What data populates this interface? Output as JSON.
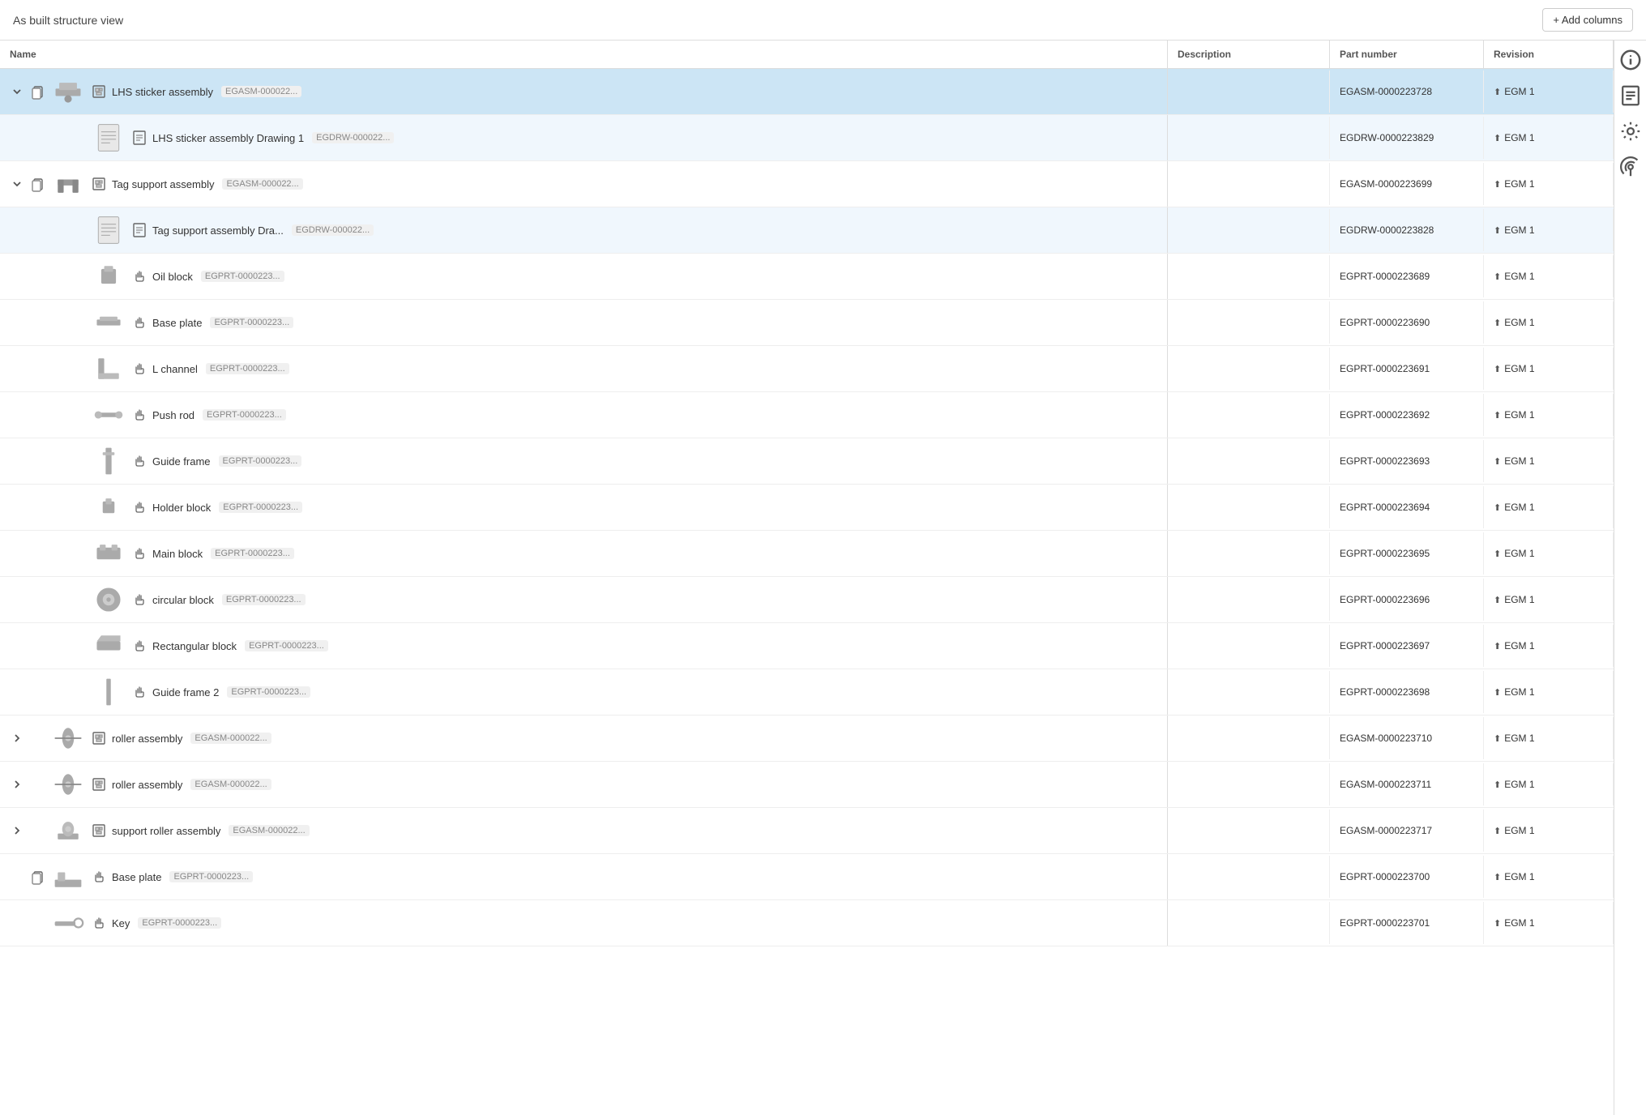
{
  "header": {
    "title": "As built structure view",
    "add_columns_label": "+ Add columns"
  },
  "columns": {
    "name": "Name",
    "description": "Description",
    "part_number": "Part number",
    "revision": "Revision"
  },
  "rows": [
    {
      "id": "lhs-sticker-asm",
      "level": 0,
      "expanded": true,
      "selected": true,
      "has_children": true,
      "has_copy_icon": true,
      "type": "assembly",
      "name": "LHS sticker assembly",
      "tag": "EGASM-000022...",
      "description": "",
      "part_number": "EGASM-0000223728",
      "revision": "EGM 1",
      "thumb_shape": "complex"
    },
    {
      "id": "lhs-sticker-drw",
      "level": 1,
      "expanded": false,
      "selected": false,
      "has_children": false,
      "has_copy_icon": false,
      "type": "drawing",
      "name": "LHS sticker assembly Drawing 1",
      "tag": "EGDRW-000022...",
      "description": "",
      "part_number": "EGDRW-0000223829",
      "revision": "EGM 1",
      "thumb_shape": "document",
      "sub_row": true
    },
    {
      "id": "tag-support-asm",
      "level": 0,
      "expanded": true,
      "selected": false,
      "has_children": true,
      "has_copy_icon": true,
      "type": "assembly",
      "name": "Tag support assembly",
      "tag": "EGASM-000022...",
      "description": "",
      "part_number": "EGASM-0000223699",
      "revision": "EGM 1",
      "thumb_shape": "bracket"
    },
    {
      "id": "tag-support-drw",
      "level": 1,
      "expanded": false,
      "selected": false,
      "has_children": false,
      "has_copy_icon": false,
      "type": "drawing",
      "name": "Tag support assembly Dra...",
      "tag": "EGDRW-000022...",
      "description": "",
      "part_number": "EGDRW-0000223828",
      "revision": "EGM 1",
      "thumb_shape": "document",
      "sub_row": true
    },
    {
      "id": "oil-block",
      "level": 1,
      "expanded": false,
      "selected": false,
      "has_children": false,
      "has_copy_icon": false,
      "type": "part",
      "name": "Oil block",
      "tag": "EGPRT-0000223...",
      "description": "",
      "part_number": "EGPRT-0000223689",
      "revision": "EGM 1",
      "thumb_shape": "small-block"
    },
    {
      "id": "base-plate",
      "level": 1,
      "expanded": false,
      "selected": false,
      "has_children": false,
      "has_copy_icon": false,
      "type": "part",
      "name": "Base plate",
      "tag": "EGPRT-0000223...",
      "description": "",
      "part_number": "EGPRT-0000223690",
      "revision": "EGM 1",
      "thumb_shape": "plate"
    },
    {
      "id": "l-channel",
      "level": 1,
      "expanded": false,
      "selected": false,
      "has_children": false,
      "has_copy_icon": false,
      "type": "part",
      "name": "L channel",
      "tag": "EGPRT-0000223...",
      "description": "",
      "part_number": "EGPRT-0000223691",
      "revision": "EGM 1",
      "thumb_shape": "l-channel"
    },
    {
      "id": "push-rod",
      "level": 1,
      "expanded": false,
      "selected": false,
      "has_children": false,
      "has_copy_icon": false,
      "type": "part",
      "name": "Push rod",
      "tag": "EGPRT-0000223...",
      "description": "",
      "part_number": "EGPRT-0000223692",
      "revision": "EGM 1",
      "thumb_shape": "rod"
    },
    {
      "id": "guide-frame",
      "level": 1,
      "expanded": false,
      "selected": false,
      "has_children": false,
      "has_copy_icon": false,
      "type": "part",
      "name": "Guide frame",
      "tag": "EGPRT-0000223...",
      "description": "",
      "part_number": "EGPRT-0000223693",
      "revision": "EGM 1",
      "thumb_shape": "thin-frame"
    },
    {
      "id": "holder-block",
      "level": 1,
      "expanded": false,
      "selected": false,
      "has_children": false,
      "has_copy_icon": false,
      "type": "part",
      "name": "Holder block",
      "tag": "EGPRT-0000223...",
      "description": "",
      "part_number": "EGPRT-0000223694",
      "revision": "EGM 1",
      "thumb_shape": "small-block2"
    },
    {
      "id": "main-block",
      "level": 1,
      "expanded": false,
      "selected": false,
      "has_children": false,
      "has_copy_icon": false,
      "type": "part",
      "name": "Main block",
      "tag": "EGPRT-0000223...",
      "description": "",
      "part_number": "EGPRT-0000223695",
      "revision": "EGM 1",
      "thumb_shape": "main-block"
    },
    {
      "id": "circular-block",
      "level": 1,
      "expanded": false,
      "selected": false,
      "has_children": false,
      "has_copy_icon": false,
      "type": "part",
      "name": "circular block",
      "tag": "EGPRT-0000223...",
      "description": "",
      "part_number": "EGPRT-0000223696",
      "revision": "EGM 1",
      "thumb_shape": "circular"
    },
    {
      "id": "rectangular-block",
      "level": 1,
      "expanded": false,
      "selected": false,
      "has_children": false,
      "has_copy_icon": false,
      "type": "part",
      "name": "Rectangular block",
      "tag": "EGPRT-0000223...",
      "description": "",
      "part_number": "EGPRT-0000223697",
      "revision": "EGM 1",
      "thumb_shape": "rect-block"
    },
    {
      "id": "guide-frame-2",
      "level": 1,
      "expanded": false,
      "selected": false,
      "has_children": false,
      "has_copy_icon": false,
      "type": "part",
      "name": "Guide frame 2",
      "tag": "EGPRT-0000223...",
      "description": "",
      "part_number": "EGPRT-0000223698",
      "revision": "EGM 1",
      "thumb_shape": "thin-frame2"
    },
    {
      "id": "roller-asm-1",
      "level": 0,
      "expanded": false,
      "selected": false,
      "has_children": true,
      "has_copy_icon": false,
      "type": "assembly",
      "name": "roller assembly",
      "tag": "EGASM-000022...",
      "description": "",
      "part_number": "EGASM-0000223710",
      "revision": "EGM 1",
      "thumb_shape": "roller"
    },
    {
      "id": "roller-asm-2",
      "level": 0,
      "expanded": false,
      "selected": false,
      "has_children": true,
      "has_copy_icon": false,
      "type": "assembly",
      "name": "roller assembly",
      "tag": "EGASM-000022...",
      "description": "",
      "part_number": "EGASM-0000223711",
      "revision": "EGM 1",
      "thumb_shape": "roller"
    },
    {
      "id": "support-roller-asm",
      "level": 0,
      "expanded": false,
      "selected": false,
      "has_children": true,
      "has_copy_icon": false,
      "type": "assembly",
      "name": "support roller assembly",
      "tag": "EGASM-000022...",
      "description": "",
      "part_number": "EGASM-0000223717",
      "revision": "EGM 1",
      "thumb_shape": "support-roller"
    },
    {
      "id": "base-plate-2",
      "level": 0,
      "expanded": false,
      "selected": false,
      "has_children": false,
      "has_copy_icon": true,
      "type": "part",
      "name": "Base plate",
      "tag": "EGPRT-0000223...",
      "description": "",
      "part_number": "EGPRT-0000223700",
      "revision": "EGM 1",
      "thumb_shape": "base-plate2"
    },
    {
      "id": "key",
      "level": 0,
      "expanded": false,
      "selected": false,
      "has_children": false,
      "has_copy_icon": false,
      "type": "part",
      "name": "Key",
      "tag": "EGPRT-0000223...",
      "description": "",
      "part_number": "EGPRT-0000223701",
      "revision": "EGM 1",
      "thumb_shape": "key"
    }
  ],
  "sidebar_icons": [
    {
      "name": "info-icon",
      "symbol": "ℹ"
    },
    {
      "name": "list-icon",
      "symbol": "≡"
    },
    {
      "name": "settings-icon",
      "symbol": "⚙"
    },
    {
      "name": "antenna-icon",
      "symbol": "📡"
    }
  ]
}
